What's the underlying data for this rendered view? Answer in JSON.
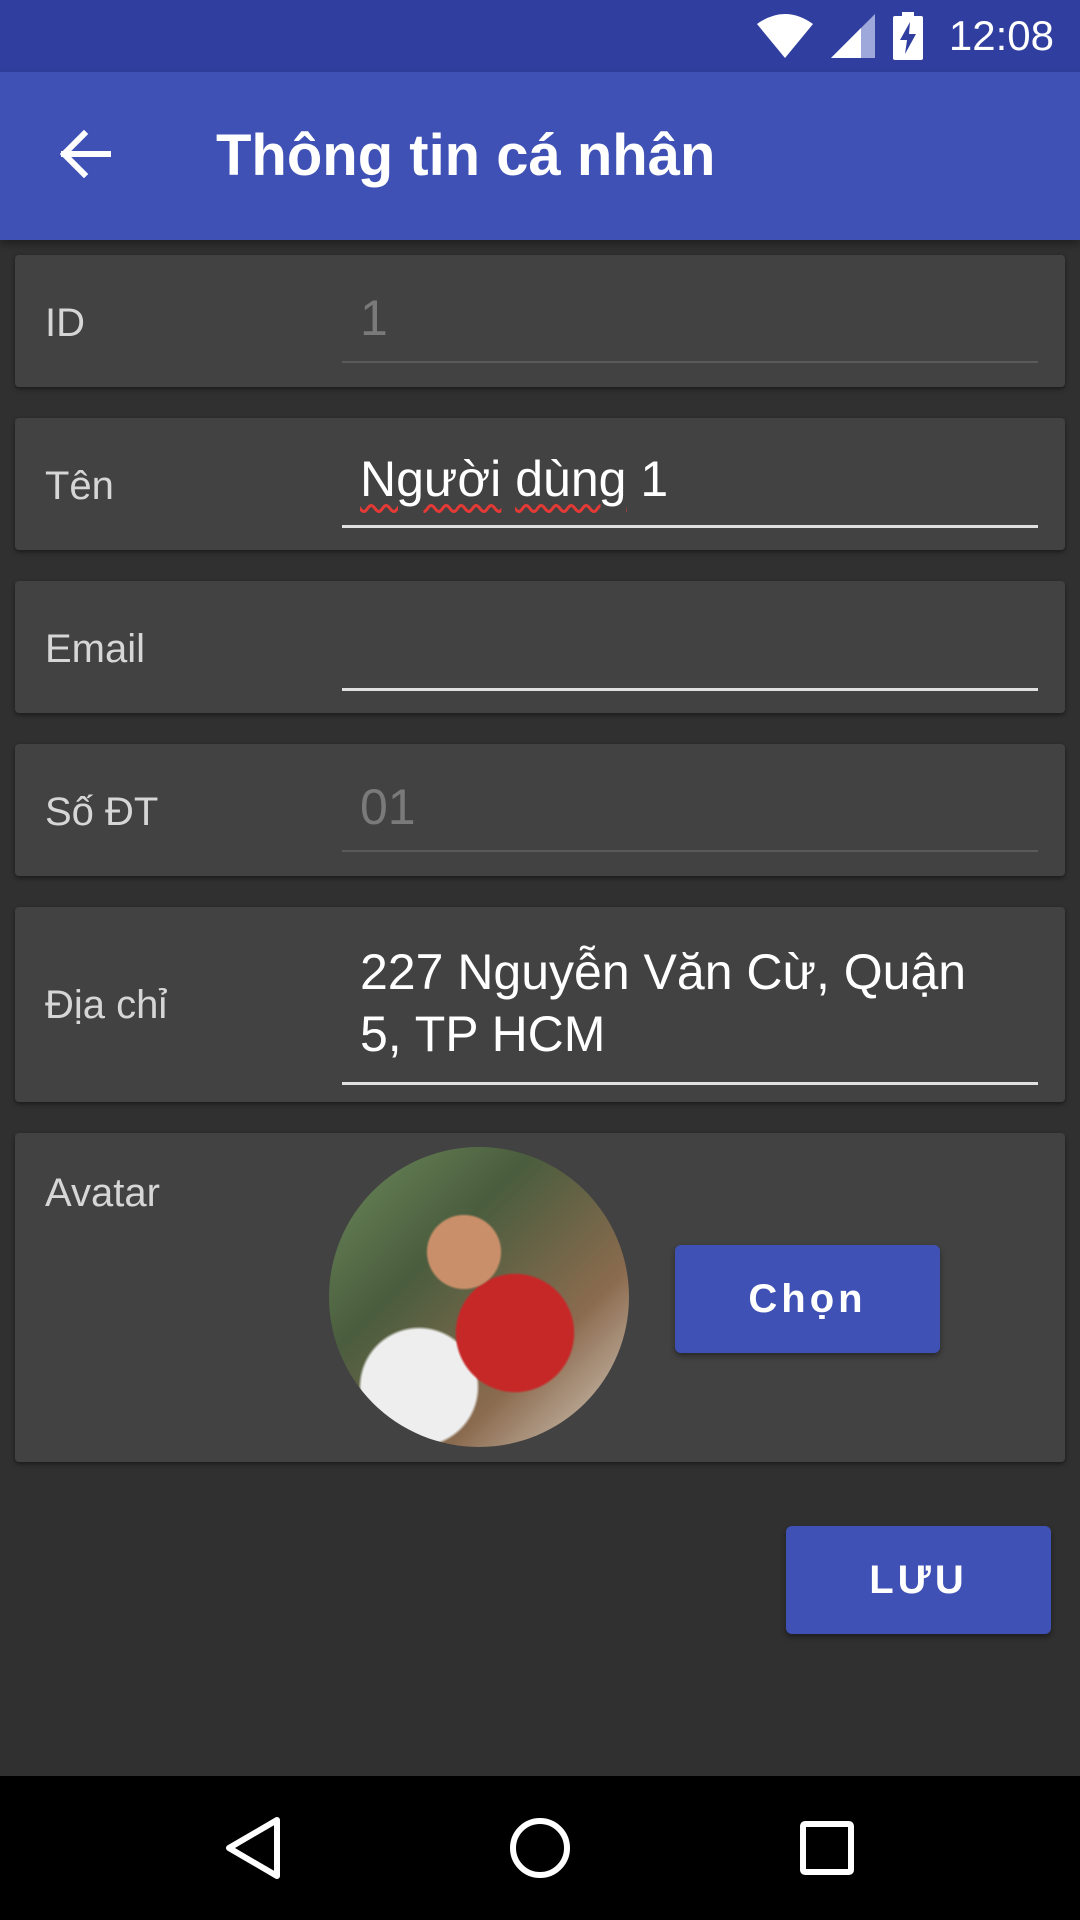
{
  "status_bar": {
    "time": "12:08"
  },
  "app_bar": {
    "title": "Thông tin cá nhân"
  },
  "form": {
    "id": {
      "label": "ID",
      "value": "1"
    },
    "name": {
      "label": "Tên",
      "value_word1": "Người",
      "value_word2": "dùng",
      "value_rest": " 1"
    },
    "email": {
      "label": "Email",
      "value": ""
    },
    "phone": {
      "label": "Số ĐT",
      "value": "01"
    },
    "address": {
      "label": "Địa chỉ",
      "line1": "227 Nguyễn Văn Cừ, Quận",
      "line2": "5, TP HCM"
    },
    "avatar": {
      "label": "Avatar",
      "choose_button": "Chọn"
    }
  },
  "save_button": "LƯU",
  "colors": {
    "primary": "#3F51B5",
    "primary_dark": "#303F9F",
    "background": "#303030",
    "card": "#424242"
  }
}
